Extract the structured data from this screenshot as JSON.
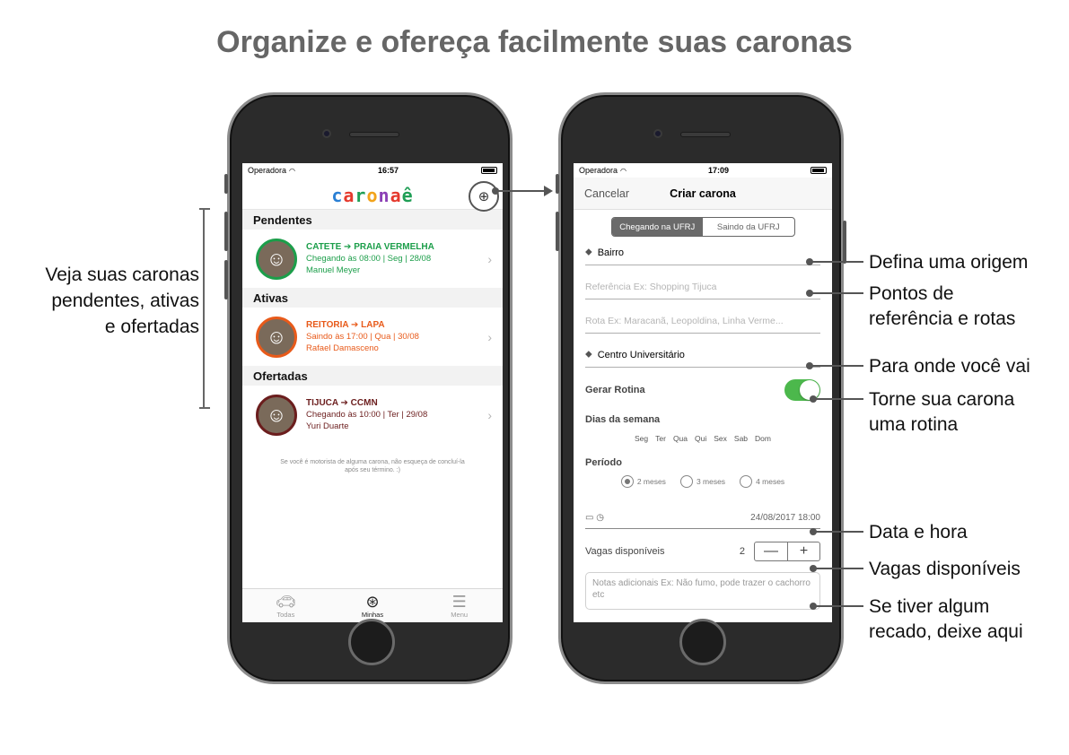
{
  "headline": "Organize e ofereça facilmente suas caronas",
  "left_annotation": [
    "Veja suas caronas",
    "pendentes, ativas",
    "e ofertadas"
  ],
  "status": {
    "carrier": "Operadora",
    "wifi_icon": "wifi-icon",
    "time1": "16:57",
    "time2": "17:09"
  },
  "app": {
    "logo_letters": [
      "c",
      "a",
      "r",
      "o",
      "n",
      "a",
      "ê"
    ],
    "logo_colors": [
      "#2a7fd4",
      "#e5392d",
      "#1f9e55",
      "#f2a31b",
      "#8b3fb5",
      "#e5392d",
      "#1f9e55"
    ],
    "sections": [
      {
        "header": "Pendentes",
        "route": "CATETE ➔ PRAIA VERMELHA",
        "detail": "Chegando às 08:00 | Seg | 28/08",
        "driver": "Manuel Meyer",
        "color": "#1c9e4a"
      },
      {
        "header": "Ativas",
        "route": "REITORIA ➔ LAPA",
        "detail": "Saindo às 17:00 | Qua | 30/08",
        "driver": "Rafael Damasceno",
        "color": "#e85a1a"
      },
      {
        "header": "Ofertadas",
        "route": "TIJUCA ➔ CCMN",
        "detail": "Chegando às 10:00 | Ter | 29/08",
        "driver": "Yuri Duarte",
        "color": "#6b1d1d"
      }
    ],
    "footnote": "Se você é motorista de alguma carona, não esqueça de concluí-la após seu término. :)",
    "tabs": [
      "Todas",
      "Minhas",
      "Menu"
    ]
  },
  "form": {
    "cancel": "Cancelar",
    "title": "Criar carona",
    "segments": [
      "Chegando na UFRJ",
      "Saindo da UFRJ"
    ],
    "origin": "Bairro",
    "reference_placeholder": "Referência Ex: Shopping Tijuca",
    "route_placeholder": "Rota Ex: Maracanã, Leopoldina, Linha Verme...",
    "destination": "Centro Universitário",
    "routine_label": "Gerar Rotina",
    "days_label": "Dias da semana",
    "days": [
      "Seg",
      "Ter",
      "Qua",
      "Qui",
      "Sex",
      "Sab",
      "Dom"
    ],
    "period_label": "Período",
    "periods": [
      "2 meses",
      "3 meses",
      "4 meses"
    ],
    "datetime": "24/08/2017 18:00",
    "seats_label": "Vagas disponíveis",
    "seats_value": "2",
    "stepper_minus": "—",
    "stepper_plus": "+",
    "notes_placeholder": "Notas adicionais Ex: Não fumo, pode trazer o cachorro etc"
  },
  "annotations": {
    "origin": "Defina uma origem",
    "refs_1": "Pontos de",
    "refs_2": "referência e rotas",
    "dest": "Para onde você vai",
    "routine_1": "Torne sua carona",
    "routine_2": "uma rotina",
    "date": "Data e hora",
    "seats": "Vagas disponíveis",
    "notes_1": "Se tiver algum",
    "notes_2": "recado, deixe aqui"
  }
}
